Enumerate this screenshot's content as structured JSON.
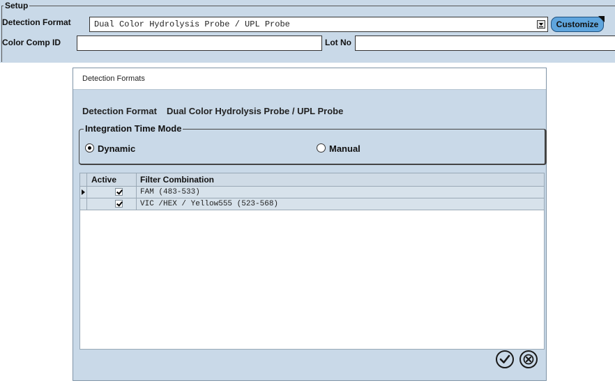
{
  "setup": {
    "legend": "Setup",
    "detection_format_label": "Detection Format",
    "detection_format_value": "Dual Color Hydrolysis Probe / UPL Probe",
    "customize_label": "Customize",
    "color_comp_label": "Color Comp ID",
    "color_comp_value": "",
    "lot_no_label": "Lot No",
    "lot_no_value": ""
  },
  "dialog": {
    "title": "Detection Formats",
    "detection_format_label": "Detection Format",
    "detection_format_value": "Dual Color Hydrolysis Probe / UPL Probe",
    "integration": {
      "legend": "Integration Time Mode",
      "options": [
        {
          "label": "Dynamic",
          "selected": true
        },
        {
          "label": "Manual",
          "selected": false
        }
      ]
    },
    "grid": {
      "columns": [
        "Active",
        "Filter Combination"
      ],
      "rows": [
        {
          "active": true,
          "filter": "FAM (483-533)",
          "current": true
        },
        {
          "active": true,
          "filter": "VIC /HEX / Yellow555 (523-568)",
          "current": false
        }
      ]
    },
    "buttons": {
      "ok_icon": "check-circle-icon",
      "cancel_icon": "x-circle-icon"
    }
  },
  "colors": {
    "panel_bg": "#c9d9e8",
    "customize_bg": "#5fa5dd",
    "grid_row_bg": "#d7e2eb"
  }
}
